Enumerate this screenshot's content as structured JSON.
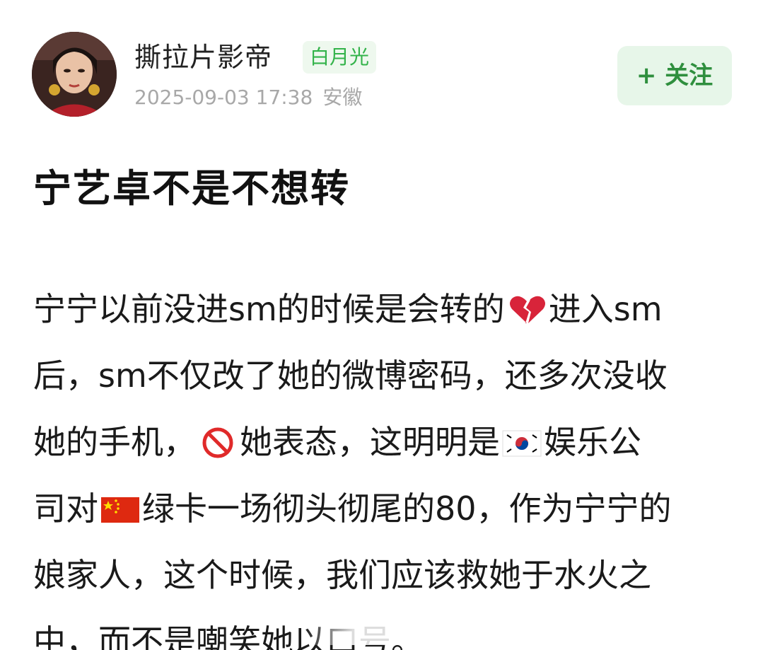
{
  "post": {
    "author": {
      "name": "撕拉片影帝",
      "badge": "白月光",
      "timestamp": "2025-09-03 17:38",
      "location": "安徽",
      "avatar_icon": "avatar-photo"
    },
    "follow_button": "+ 关注",
    "title": "宁艺卓不是不想转",
    "body": {
      "line1_a": "宁宁以前没进sm的时候是会转的",
      "line1_icon": "broken-heart-icon",
      "line1_b": "进入sm",
      "line2": "后，sm不仅改了她的微博密码，还多次没收",
      "line3_a": "她的手机，",
      "line3_icon": "prohibited-icon",
      "line3_b": "她表态，这明明是",
      "line3_icon2": "korea-flag-icon",
      "line3_c": "娱乐公",
      "line4_a": "司对",
      "line4_icon": "china-flag-icon",
      "line4_b": "绿卡一场彻头彻尾的80，作为宁宁的",
      "line5": "娘家人，这个时候，我们应该救她于水火之",
      "line6": "中，而不是嘲笑她以口号。"
    }
  },
  "colors": {
    "badge_text": "#33b34a",
    "badge_bg": "#eef8ee",
    "follow_bg": "#e7f6e9",
    "follow_text": "#2f8f3e",
    "meta_text": "#a8a8a8"
  }
}
